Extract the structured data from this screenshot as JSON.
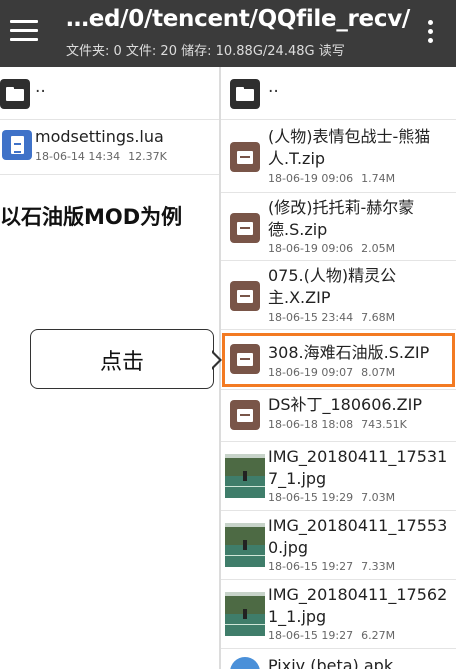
{
  "toolbar": {
    "path": "…ed/0/tencent/QQfile_recv/",
    "stats": "文件夹: 0  文件: 20  储存: 10.88G/24.48G  读写"
  },
  "left_pane": {
    "parent": "..",
    "files": [
      {
        "name": "modsettings.lua",
        "date": "18-06-14 14:34",
        "size": "12.37K",
        "icon": "lua-file-icon"
      }
    ]
  },
  "right_pane": {
    "parent": "..",
    "files": [
      {
        "name_line1": "(人物)表情包战士-熊猫",
        "name_line2": "人.T.zip",
        "date": "18-06-19 09:06",
        "size": "1.74M",
        "icon": "archive-icon"
      },
      {
        "name_line1": "(修改)托托莉-赫尔蒙",
        "name_line2": "德.S.zip",
        "date": "18-06-19 09:06",
        "size": "2.05M",
        "icon": "archive-icon"
      },
      {
        "name_line1": "075.(人物)精灵公",
        "name_line2": "主.X.ZIP",
        "date": "18-06-15 23:44",
        "size": "7.68M",
        "icon": "archive-icon"
      },
      {
        "name_line1": "308.海难石油版.S.ZIP",
        "name_line2": "",
        "date": "18-06-19 09:07",
        "size": "8.07M",
        "icon": "archive-icon"
      },
      {
        "name_line1": "DS补丁_180606.ZIP",
        "name_line2": "",
        "date": "18-06-18 18:08",
        "size": "743.51K",
        "icon": "archive-icon"
      },
      {
        "name_line1": "IMG_20180411_17531",
        "name_line2": "7_1.jpg",
        "date": "18-06-15 19:29",
        "size": "7.03M",
        "icon": "image-thumbnail"
      },
      {
        "name_line1": "IMG_20180411_17553",
        "name_line2": "0.jpg",
        "date": "18-06-15 19:27",
        "size": "7.33M",
        "icon": "image-thumbnail"
      },
      {
        "name_line1": "IMG_20180411_17562",
        "name_line2": "1_1.jpg",
        "date": "18-06-15 19:27",
        "size": "6.27M",
        "icon": "image-thumbnail"
      },
      {
        "name_line1": "Pixiv (beta).apk",
        "name_line2": "",
        "date": "",
        "size": "",
        "icon": "apk-icon"
      }
    ]
  },
  "annotation": {
    "caption": "以石油版MOD为例",
    "callout": "点击",
    "highlight_color": "#f37a22"
  },
  "colors": {
    "toolbar_bg": "#3b3b3b",
    "archive_icon": "#795548",
    "doc_icon": "#3f72c8",
    "folder_icon": "#2f2f2f"
  }
}
